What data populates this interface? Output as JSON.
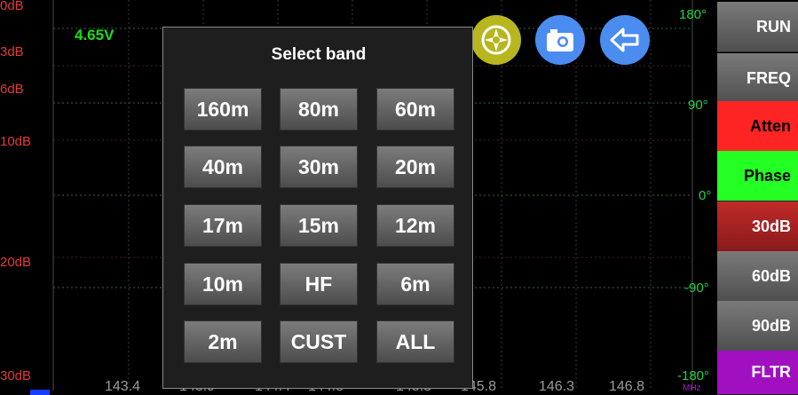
{
  "status": {
    "voltage": "4.65V"
  },
  "y_left_labels": [
    "0dB",
    "3dB",
    "6dB",
    "10dB",
    "20dB",
    "30dB"
  ],
  "y_right_labels": [
    "180°",
    "90°",
    "0°",
    "-90°",
    "-180°"
  ],
  "x_labels": [
    "143.4",
    "143.9",
    "144.4",
    "144.8",
    "145.3",
    "145.8",
    "146.3",
    "146.8"
  ],
  "x_unit": "MHz",
  "toolbar": {
    "icons": [
      "target-icon",
      "camera-icon",
      "back-arrow-icon"
    ]
  },
  "side_buttons": [
    {
      "label": "RUN",
      "color": "#666666"
    },
    {
      "label": "FREQ",
      "color": "#666666"
    },
    {
      "label": "Atten",
      "color": "#ff2020"
    },
    {
      "label": "Phase",
      "color": "#20ff20"
    },
    {
      "label": "30dB",
      "color": "#b02020"
    },
    {
      "label": "60dB",
      "color": "#666666"
    },
    {
      "label": "90dB",
      "color": "#666666"
    },
    {
      "label": "FLTR",
      "color": "#a000c0"
    }
  ],
  "dialog": {
    "title": "Select band",
    "bands": [
      "160m",
      "80m",
      "60m",
      "40m",
      "30m",
      "20m",
      "17m",
      "15m",
      "12m",
      "10m",
      "HF",
      "6m",
      "2m",
      "CUST",
      "ALL"
    ]
  }
}
